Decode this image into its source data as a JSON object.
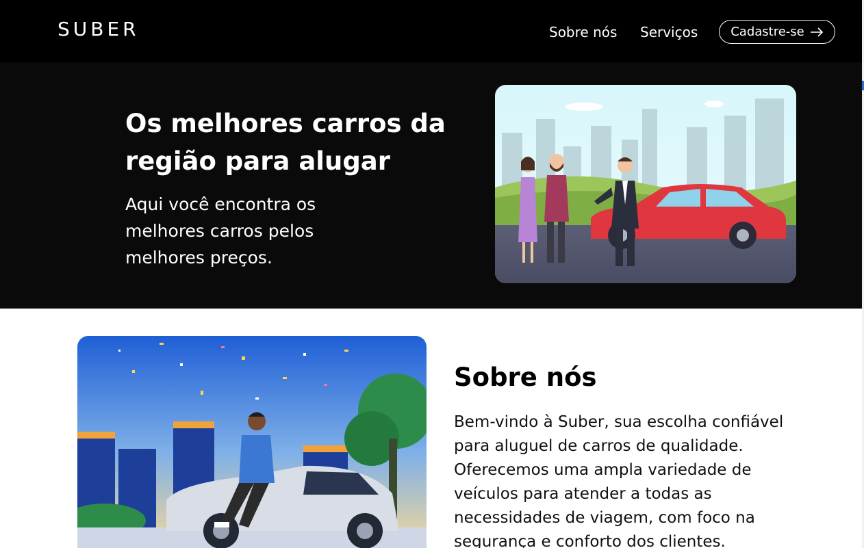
{
  "nav": {
    "logo": "SUBER",
    "links": [
      "Sobre nós",
      "Serviços"
    ],
    "signup": "Cadastre-se"
  },
  "hero": {
    "title": "Os melhores carros da região para alugar",
    "subtitle": "Aqui você encontra os melhores carros pelos melhores preços."
  },
  "about": {
    "title": "Sobre nós",
    "text": "Bem-vindo à Suber, sua escolha confiável para aluguel de carros de qualidade. Oferecemos uma ampla variedade de veículos para atender a todas as necessidades de viagem, com foco na segurança e conforto dos clientes."
  },
  "colors": {
    "nav_bg": "#000000",
    "hero_bg": "#0a0a0a",
    "car_red": "#e0363f",
    "car_silver": "#d8dde6"
  }
}
